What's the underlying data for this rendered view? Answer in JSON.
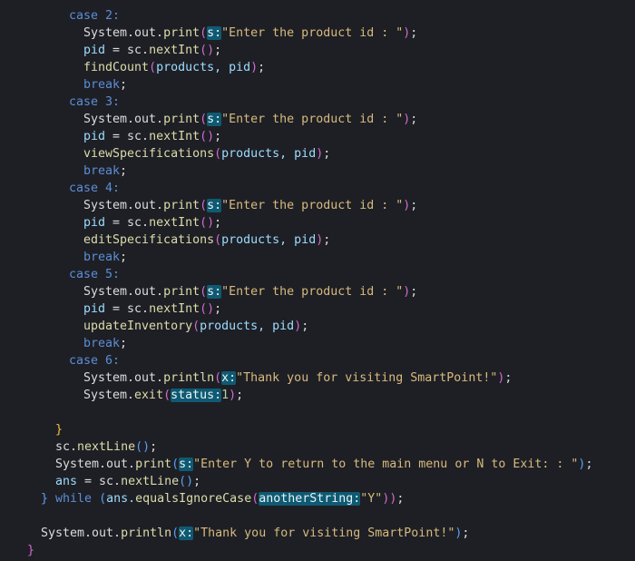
{
  "colors": {
    "background": "#1e1f25",
    "keyword": "#5b8ed6",
    "text": "#dcdcdc",
    "method": "#dcdcaa",
    "param": "#9cdcfe",
    "string": "#d7ba7d",
    "number": "#b5cea8",
    "paren_level1": "#d26bd1",
    "paren_level2": "#5aa0f2",
    "brace": "#f3c13a",
    "inlay_hint_bg": "#0f5a72"
  },
  "lines": [
    {
      "indent": 76,
      "tokens": [
        {
          "t": "case",
          "c": "keyword"
        },
        {
          "t": " 2:",
          "c": "keyword"
        }
      ]
    },
    {
      "indent": 92,
      "tokens": [
        {
          "t": "System.out.",
          "c": "text"
        },
        {
          "t": "print",
          "c": "method"
        },
        {
          "t": "(",
          "c": "paren_level1"
        },
        {
          "t": "s:",
          "c": "hint"
        },
        {
          "t": "\"Enter the product id : \"",
          "c": "string"
        },
        {
          "t": ")",
          "c": "paren_level1"
        },
        {
          "t": ";",
          "c": "text"
        }
      ]
    },
    {
      "indent": 92,
      "tokens": [
        {
          "t": "pid",
          "c": "param"
        },
        {
          "t": " = sc.",
          "c": "text"
        },
        {
          "t": "nextInt",
          "c": "method"
        },
        {
          "t": "()",
          "c": "paren_level1"
        },
        {
          "t": ";",
          "c": "text"
        }
      ]
    },
    {
      "indent": 92,
      "tokens": [
        {
          "t": "findCount",
          "c": "method"
        },
        {
          "t": "(",
          "c": "paren_level1"
        },
        {
          "t": "products, pid",
          "c": "param"
        },
        {
          "t": ")",
          "c": "paren_level1"
        },
        {
          "t": ";",
          "c": "text"
        }
      ]
    },
    {
      "indent": 92,
      "tokens": [
        {
          "t": "break",
          "c": "keyword"
        },
        {
          "t": ";",
          "c": "text"
        }
      ]
    },
    {
      "indent": 76,
      "tokens": [
        {
          "t": "case",
          "c": "keyword"
        },
        {
          "t": " 3:",
          "c": "keyword"
        }
      ]
    },
    {
      "indent": 92,
      "tokens": [
        {
          "t": "System.out.",
          "c": "text"
        },
        {
          "t": "print",
          "c": "method"
        },
        {
          "t": "(",
          "c": "paren_level1"
        },
        {
          "t": "s:",
          "c": "hint"
        },
        {
          "t": "\"Enter the product id : \"",
          "c": "string"
        },
        {
          "t": ")",
          "c": "paren_level1"
        },
        {
          "t": ";",
          "c": "text"
        }
      ]
    },
    {
      "indent": 92,
      "tokens": [
        {
          "t": "pid",
          "c": "param"
        },
        {
          "t": " = sc.",
          "c": "text"
        },
        {
          "t": "nextInt",
          "c": "method"
        },
        {
          "t": "()",
          "c": "paren_level1"
        },
        {
          "t": ";",
          "c": "text"
        }
      ]
    },
    {
      "indent": 92,
      "tokens": [
        {
          "t": "viewSpecifications",
          "c": "method"
        },
        {
          "t": "(",
          "c": "paren_level1"
        },
        {
          "t": "products, pid",
          "c": "param"
        },
        {
          "t": ")",
          "c": "paren_level1"
        },
        {
          "t": ";",
          "c": "text"
        }
      ]
    },
    {
      "indent": 92,
      "tokens": [
        {
          "t": "break",
          "c": "keyword"
        },
        {
          "t": ";",
          "c": "text"
        }
      ]
    },
    {
      "indent": 76,
      "tokens": [
        {
          "t": "case",
          "c": "keyword"
        },
        {
          "t": " 4:",
          "c": "keyword"
        }
      ]
    },
    {
      "indent": 92,
      "tokens": [
        {
          "t": "System.out.",
          "c": "text"
        },
        {
          "t": "print",
          "c": "method"
        },
        {
          "t": "(",
          "c": "paren_level1"
        },
        {
          "t": "s:",
          "c": "hint"
        },
        {
          "t": "\"Enter the product id : \"",
          "c": "string"
        },
        {
          "t": ")",
          "c": "paren_level1"
        },
        {
          "t": ";",
          "c": "text"
        }
      ]
    },
    {
      "indent": 92,
      "tokens": [
        {
          "t": "pid",
          "c": "param"
        },
        {
          "t": " = sc.",
          "c": "text"
        },
        {
          "t": "nextInt",
          "c": "method"
        },
        {
          "t": "()",
          "c": "paren_level1"
        },
        {
          "t": ";",
          "c": "text"
        }
      ]
    },
    {
      "indent": 92,
      "tokens": [
        {
          "t": "editSpecifications",
          "c": "method"
        },
        {
          "t": "(",
          "c": "paren_level1"
        },
        {
          "t": "products, pid",
          "c": "param"
        },
        {
          "t": ")",
          "c": "paren_level1"
        },
        {
          "t": ";",
          "c": "text"
        }
      ]
    },
    {
      "indent": 92,
      "tokens": [
        {
          "t": "break",
          "c": "keyword"
        },
        {
          "t": ";",
          "c": "text"
        }
      ]
    },
    {
      "indent": 76,
      "tokens": [
        {
          "t": "case",
          "c": "keyword"
        },
        {
          "t": " 5:",
          "c": "keyword"
        }
      ]
    },
    {
      "indent": 92,
      "tokens": [
        {
          "t": "System.out.",
          "c": "text"
        },
        {
          "t": "print",
          "c": "method"
        },
        {
          "t": "(",
          "c": "paren_level1"
        },
        {
          "t": "s:",
          "c": "hint"
        },
        {
          "t": "\"Enter the product id : \"",
          "c": "string"
        },
        {
          "t": ")",
          "c": "paren_level1"
        },
        {
          "t": ";",
          "c": "text"
        }
      ]
    },
    {
      "indent": 92,
      "tokens": [
        {
          "t": "pid",
          "c": "param"
        },
        {
          "t": " = sc.",
          "c": "text"
        },
        {
          "t": "nextInt",
          "c": "method"
        },
        {
          "t": "()",
          "c": "paren_level1"
        },
        {
          "t": ";",
          "c": "text"
        }
      ]
    },
    {
      "indent": 92,
      "tokens": [
        {
          "t": "updateInventory",
          "c": "method"
        },
        {
          "t": "(",
          "c": "paren_level1"
        },
        {
          "t": "products, pid",
          "c": "param"
        },
        {
          "t": ")",
          "c": "paren_level1"
        },
        {
          "t": ";",
          "c": "text"
        }
      ]
    },
    {
      "indent": 92,
      "tokens": [
        {
          "t": "break",
          "c": "keyword"
        },
        {
          "t": ";",
          "c": "text"
        }
      ]
    },
    {
      "indent": 76,
      "tokens": [
        {
          "t": "case",
          "c": "keyword"
        },
        {
          "t": " 6:",
          "c": "keyword"
        }
      ]
    },
    {
      "indent": 92,
      "tokens": [
        {
          "t": "System.out.",
          "c": "text"
        },
        {
          "t": "println",
          "c": "method"
        },
        {
          "t": "(",
          "c": "paren_level1"
        },
        {
          "t": "x:",
          "c": "hint"
        },
        {
          "t": "\"Thank you for visiting SmartPoint!\"",
          "c": "string"
        },
        {
          "t": ")",
          "c": "paren_level1"
        },
        {
          "t": ";",
          "c": "text"
        }
      ]
    },
    {
      "indent": 92,
      "tokens": [
        {
          "t": "System.",
          "c": "text"
        },
        {
          "t": "exit",
          "c": "method"
        },
        {
          "t": "(",
          "c": "paren_level1"
        },
        {
          "t": "status:",
          "c": "hint"
        },
        {
          "t": "1",
          "c": "number"
        },
        {
          "t": ")",
          "c": "paren_level1"
        },
        {
          "t": ";",
          "c": "text"
        }
      ]
    },
    {
      "indent": 0,
      "tokens": []
    },
    {
      "indent": 61,
      "tokens": [
        {
          "t": "}",
          "c": "brace"
        }
      ]
    },
    {
      "indent": 61,
      "tokens": [
        {
          "t": "sc.",
          "c": "text"
        },
        {
          "t": "nextLine",
          "c": "method"
        },
        {
          "t": "()",
          "c": "paren_level2"
        },
        {
          "t": ";",
          "c": "text"
        }
      ]
    },
    {
      "indent": 61,
      "tokens": [
        {
          "t": "System.out.",
          "c": "text"
        },
        {
          "t": "print",
          "c": "method"
        },
        {
          "t": "(",
          "c": "paren_level2"
        },
        {
          "t": "s:",
          "c": "hint"
        },
        {
          "t": "\"Enter Y to return to the main menu or N to Exit: : \"",
          "c": "string"
        },
        {
          "t": ")",
          "c": "paren_level2"
        },
        {
          "t": ";",
          "c": "text"
        }
      ]
    },
    {
      "indent": 61,
      "tokens": [
        {
          "t": "ans",
          "c": "param"
        },
        {
          "t": " = sc.",
          "c": "text"
        },
        {
          "t": "nextLine",
          "c": "method"
        },
        {
          "t": "()",
          "c": "paren_level2"
        },
        {
          "t": ";",
          "c": "text"
        }
      ]
    },
    {
      "indent": 45,
      "tokens": [
        {
          "t": "}",
          "c": "paren_level2"
        },
        {
          "t": " while",
          "c": "keyword"
        },
        {
          "t": " (",
          "c": "paren_level2"
        },
        {
          "t": "ans.",
          "c": "param"
        },
        {
          "t": "equalsIgnoreCase",
          "c": "method"
        },
        {
          "t": "(",
          "c": "paren_level1"
        },
        {
          "t": "anotherString:",
          "c": "hint"
        },
        {
          "t": "\"Y\"",
          "c": "string"
        },
        {
          "t": "))",
          "c": "paren_level1"
        },
        {
          "t": ";",
          "c": "text"
        }
      ]
    },
    {
      "indent": 0,
      "tokens": []
    },
    {
      "indent": 45,
      "tokens": [
        {
          "t": "System.out.",
          "c": "text"
        },
        {
          "t": "println",
          "c": "method"
        },
        {
          "t": "(",
          "c": "paren_level2"
        },
        {
          "t": "x:",
          "c": "hint"
        },
        {
          "t": "\"Thank you for visiting SmartPoint!\"",
          "c": "string"
        },
        {
          "t": ")",
          "c": "paren_level2"
        },
        {
          "t": ";",
          "c": "text"
        }
      ]
    },
    {
      "indent": 30,
      "tokens": [
        {
          "t": "}",
          "c": "paren_level1"
        }
      ]
    }
  ]
}
